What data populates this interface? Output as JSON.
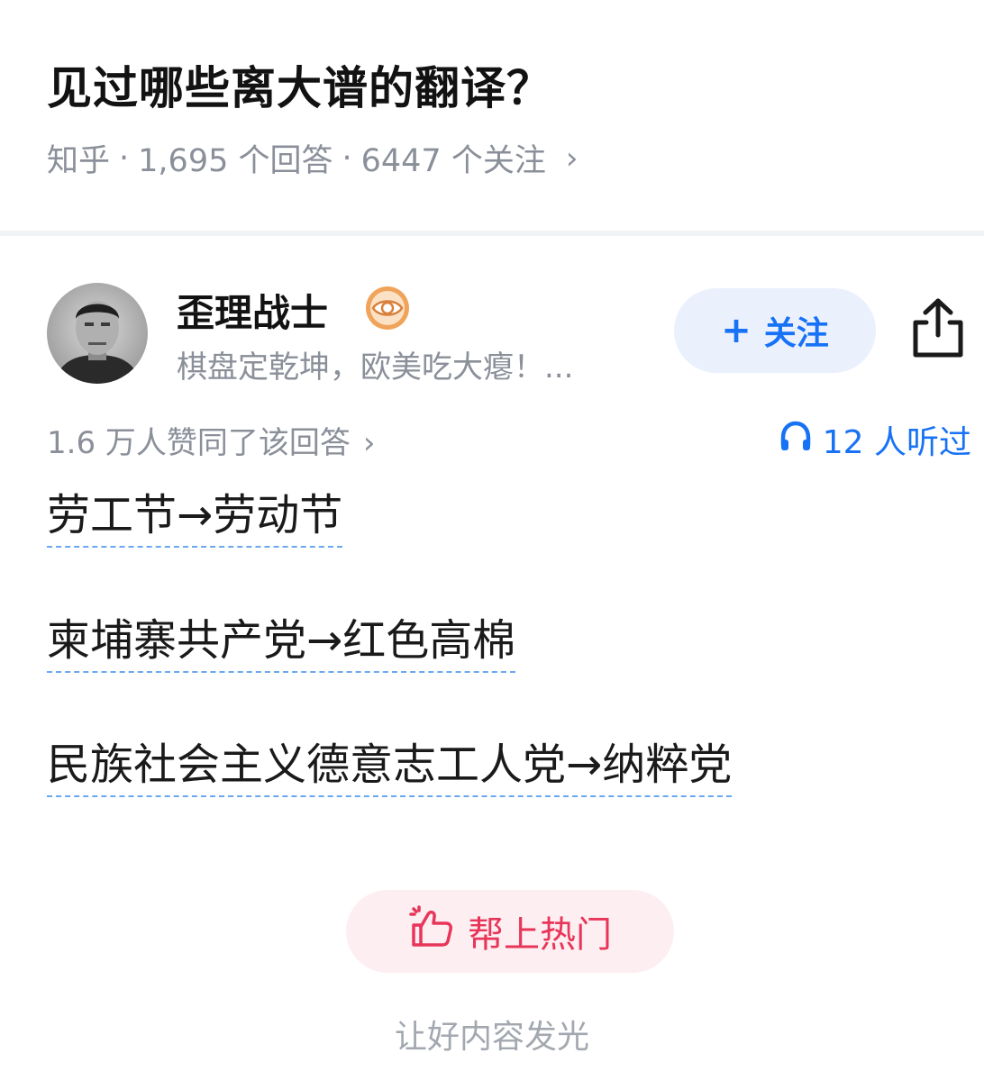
{
  "question": {
    "title": "见过哪些离大谱的翻译？",
    "source": "知乎",
    "answers": "1,695 个回答",
    "followers": "6447 个关注",
    "separator": "·",
    "chevron": "›"
  },
  "author": {
    "name": "歪理战士",
    "bio": "棋盘定乾坤，欧美吃大瘪！...",
    "badge_icon": "eye-badge-icon",
    "follow_label": "关注",
    "follow_plus": "+",
    "share_icon": "share-icon"
  },
  "stats": {
    "upvotes": "1.6 万人赞同了该回答",
    "chevron": "›",
    "listened": "12 人听过",
    "listened_icon": "headphones-icon"
  },
  "answer": {
    "lines": [
      "劳工节→劳动节",
      "柬埔寨共产党→红色高棉",
      "民族社会主义德意志工人党→纳粹党"
    ]
  },
  "hot": {
    "button_label": "帮上热门",
    "button_icon": "thumbs-up-sparkle-icon",
    "hint": "让好内容发光"
  },
  "colors": {
    "accent_blue": "#1772f6",
    "hot_red": "#e8355a",
    "meta_gray": "#8a8f99"
  }
}
